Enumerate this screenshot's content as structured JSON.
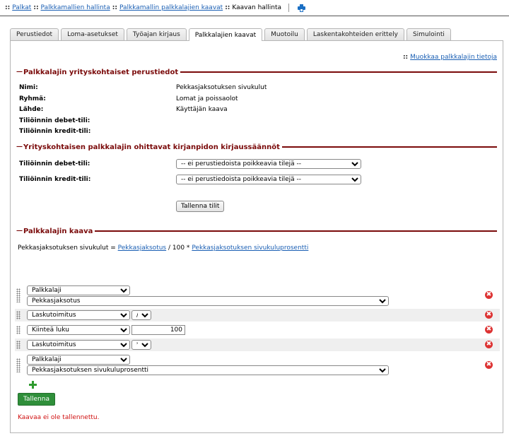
{
  "breadcrumb": {
    "items": [
      "Palkat",
      "Palkkamallien hallinta",
      "Palkkamallin palkkalajien kaavat"
    ],
    "separator": "::",
    "current": "Kaavan hallinta"
  },
  "tabs": [
    {
      "label": "Perustiedot",
      "active": false
    },
    {
      "label": "Loma-asetukset",
      "active": false
    },
    {
      "label": "Työajan kirjaus",
      "active": false
    },
    {
      "label": "Palkkalajien kaavat",
      "active": true
    },
    {
      "label": "Muotoilu",
      "active": false
    },
    {
      "label": "Laskentakohteiden erittely",
      "active": false
    },
    {
      "label": "Simulointi",
      "active": false
    }
  ],
  "edit_link": {
    "prefix": "::",
    "label": "Muokkaa palkkalajin tietoja"
  },
  "basic_info": {
    "title": "Palkkalajin yrityskohtaiset perustiedot",
    "rows": [
      {
        "label": "Nimi:",
        "value": "Pekkasjaksotuksen sivukulut"
      },
      {
        "label": "Ryhmä:",
        "value": "Lomat ja poissaolot"
      },
      {
        "label": "Lähde:",
        "value": "Käyttäjän kaava"
      },
      {
        "label": "Tiliöinnin debet-tili:",
        "value": ""
      },
      {
        "label": "Tiliöinnin kredit-tili:",
        "value": ""
      }
    ]
  },
  "override": {
    "title": "Yrityskohtaisen palkkalajin ohittavat kirjanpidon kirjaussäännöt",
    "debit_label": "Tiliöinnin debet-tili:",
    "debit_value": "-- ei perustiedoista poikkeavia tilejä --",
    "credit_label": "Tiliöinnin kredit-tili:",
    "credit_value": "-- ei perustiedoista poikkeavia tilejä --",
    "save_label": "Tallenna tilit"
  },
  "formula_section": {
    "title": "Palkkalajin kaava",
    "lhs": "Pekkasjaksotuksen sivukulut =",
    "term1": "Pekkasjaksotus",
    "operator_text": "/ 100 *",
    "term2": "Pekkasjaksotuksen sivukuluprosentti"
  },
  "formula_rows": [
    {
      "type_value": "Palkkalaji",
      "second_value": "Pekkasjaksotus"
    },
    {
      "type_value": "Laskutoimitus",
      "operator": "/"
    },
    {
      "type_value": "Kiinteä luku",
      "number": "100"
    },
    {
      "type_value": "Laskutoimitus",
      "operator": "*"
    },
    {
      "type_value": "Palkkalaji",
      "second_value": "Pekkasjaksotuksen sivukuluprosentti"
    }
  ],
  "delete_glyph": "✖",
  "save_label": "Tallenna",
  "warning": "Kaavaa ei ole tallennettu.",
  "colors": {
    "section_title": "#7a0a0a",
    "link": "#1a5fb4",
    "save_button": "#2f8f3a",
    "warning": "#d01010",
    "delete_icon": "#dd3333",
    "add_icon": "#2e9b2e"
  }
}
